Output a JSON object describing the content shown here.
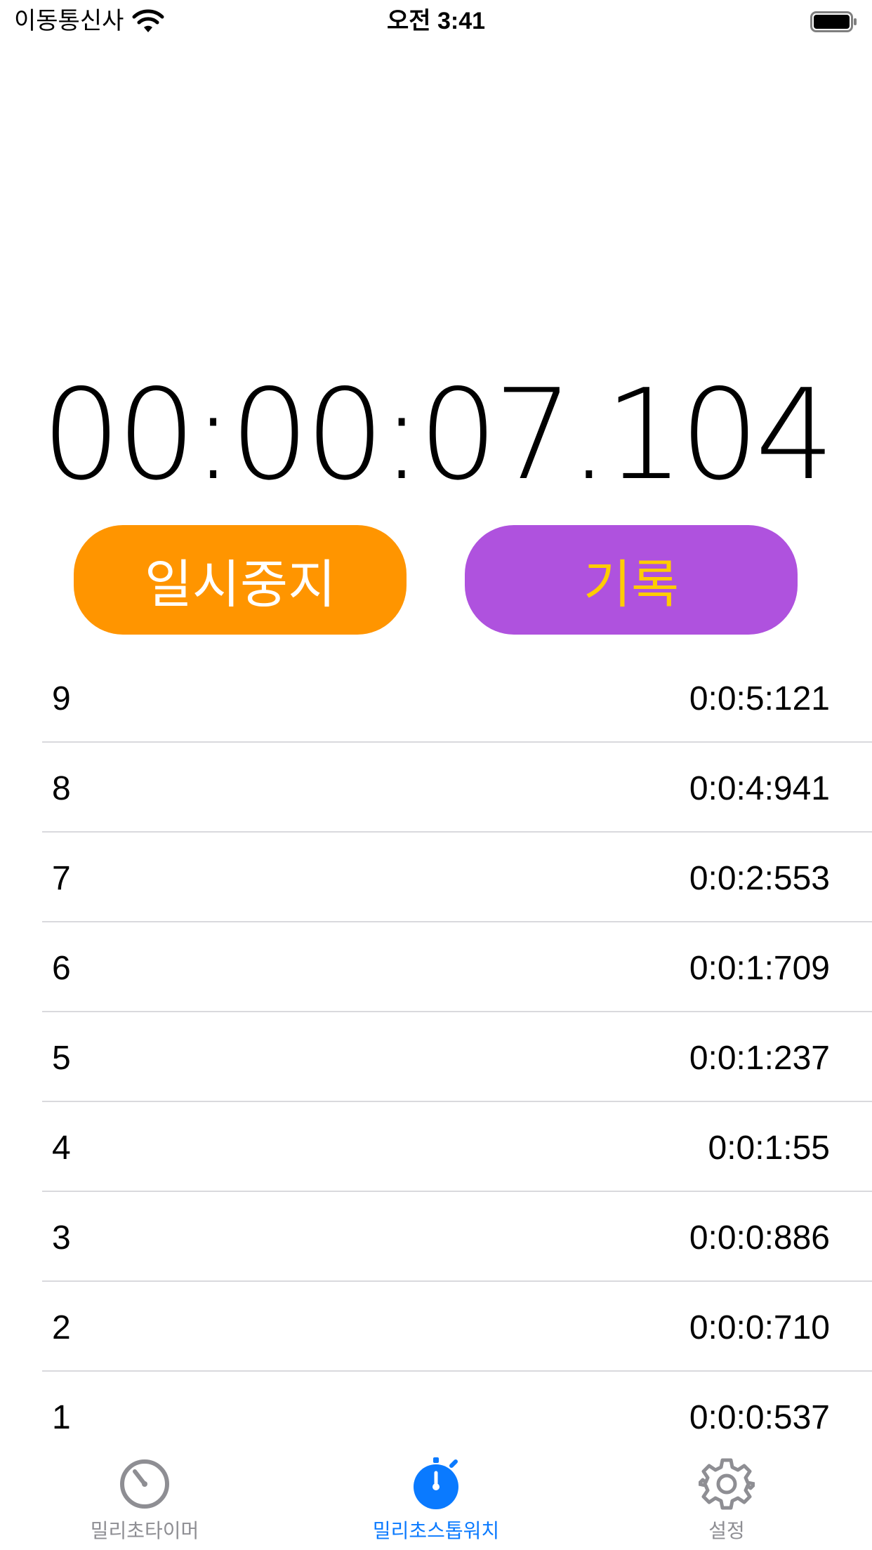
{
  "status_bar": {
    "carrier": "이동통신사",
    "time": "오전 3:41"
  },
  "timer": {
    "display": "00:00:07.104"
  },
  "buttons": {
    "pause_label": "일시중지",
    "record_label": "기록"
  },
  "laps": [
    {
      "number": "9",
      "time": "0:0:5:121"
    },
    {
      "number": "8",
      "time": "0:0:4:941"
    },
    {
      "number": "7",
      "time": "0:0:2:553"
    },
    {
      "number": "6",
      "time": "0:0:1:709"
    },
    {
      "number": "5",
      "time": "0:0:1:237"
    },
    {
      "number": "4",
      "time": "0:0:1:55"
    },
    {
      "number": "3",
      "time": "0:0:0:886"
    },
    {
      "number": "2",
      "time": "0:0:0:710"
    },
    {
      "number": "1",
      "time": "0:0:0:537"
    }
  ],
  "tab_bar": {
    "tabs": [
      {
        "label": "밀리초타이머",
        "icon": "timer-icon",
        "active": false
      },
      {
        "label": "밀리초스톱워치",
        "icon": "stopwatch-icon",
        "active": true
      },
      {
        "label": "설정",
        "icon": "gear-icon",
        "active": false
      }
    ]
  },
  "colors": {
    "pause_button": "#FF9500",
    "record_button": "#AF52DE",
    "record_text": "#FFCC00",
    "active_tab": "#0A7AFF",
    "inactive_tab": "#8E8E93"
  }
}
